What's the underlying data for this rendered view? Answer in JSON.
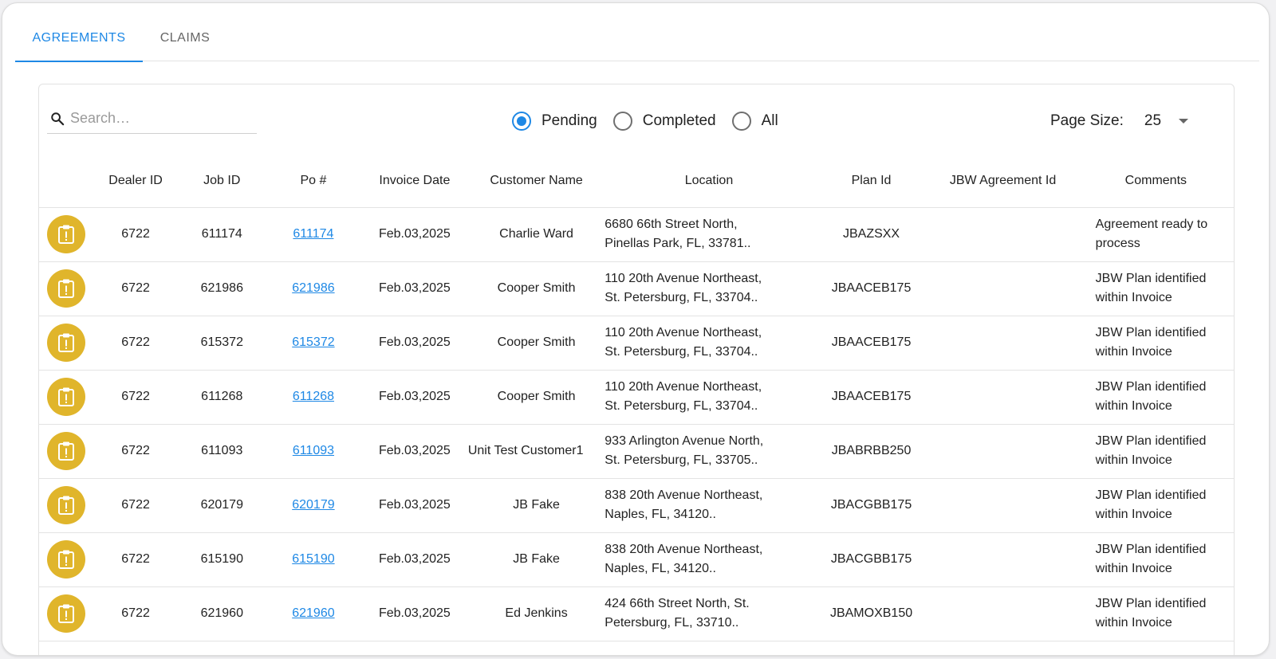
{
  "tabs": [
    {
      "label": "AGREEMENTS",
      "active": true
    },
    {
      "label": "CLAIMS",
      "active": false
    }
  ],
  "search": {
    "placeholder": "Search…",
    "value": ""
  },
  "filter": {
    "options": [
      {
        "label": "Pending",
        "checked": true
      },
      {
        "label": "Completed",
        "checked": false
      },
      {
        "label": "All",
        "checked": false
      }
    ]
  },
  "page_size": {
    "label": "Page Size:",
    "value": "25"
  },
  "table": {
    "columns": [
      "",
      "Dealer ID",
      "Job ID",
      "Po #",
      "Invoice Date",
      "Customer Name",
      "Location",
      "Plan Id",
      "JBW Agreement Id",
      "Comments"
    ],
    "rows": [
      {
        "status_icon": "clipboard-alert-icon",
        "dealer_id": "6722",
        "job_id": "611174",
        "po": "611174",
        "invoice_date": "Feb.03,2025",
        "customer": "Charlie Ward",
        "location_1": "6680 66th Street North,",
        "location_2": "Pinellas Park, FL, 33781..",
        "plan_id": "JBAZSXX",
        "agreement_id": "",
        "comment_1": "Agreement ready to",
        "comment_2": "process"
      },
      {
        "status_icon": "clipboard-alert-icon",
        "dealer_id": "6722",
        "job_id": "621986",
        "po": "621986",
        "invoice_date": "Feb.03,2025",
        "customer": "Cooper Smith",
        "location_1": "110 20th Avenue Northeast,",
        "location_2": "St. Petersburg, FL, 33704..",
        "plan_id": "JBAACEB175",
        "agreement_id": "",
        "comment_1": "JBW Plan identified",
        "comment_2": "within Invoice"
      },
      {
        "status_icon": "clipboard-alert-icon",
        "dealer_id": "6722",
        "job_id": "615372",
        "po": "615372",
        "invoice_date": "Feb.03,2025",
        "customer": "Cooper Smith",
        "location_1": "110 20th Avenue Northeast,",
        "location_2": "St. Petersburg, FL, 33704..",
        "plan_id": "JBAACEB175",
        "agreement_id": "",
        "comment_1": "JBW Plan identified",
        "comment_2": "within Invoice"
      },
      {
        "status_icon": "clipboard-alert-icon",
        "dealer_id": "6722",
        "job_id": "611268",
        "po": "611268",
        "invoice_date": "Feb.03,2025",
        "customer": "Cooper Smith",
        "location_1": "110 20th Avenue Northeast,",
        "location_2": "St. Petersburg, FL, 33704..",
        "plan_id": "JBAACEB175",
        "agreement_id": "",
        "comment_1": "JBW Plan identified",
        "comment_2": "within Invoice"
      },
      {
        "status_icon": "clipboard-alert-icon",
        "dealer_id": "6722",
        "job_id": "611093",
        "po": "611093",
        "invoice_date": "Feb.03,2025",
        "customer": "Unit Test Customer1",
        "location_1": "933 Arlington Avenue North,",
        "location_2": "St. Petersburg, FL, 33705..",
        "plan_id": "JBABRBB250",
        "agreement_id": "",
        "comment_1": "JBW Plan identified",
        "comment_2": "within Invoice"
      },
      {
        "status_icon": "clipboard-alert-icon",
        "dealer_id": "6722",
        "job_id": "620179",
        "po": "620179",
        "invoice_date": "Feb.03,2025",
        "customer": "JB Fake",
        "location_1": "838 20th Avenue Northeast,",
        "location_2": "Naples, FL, 34120..",
        "plan_id": "JBACGBB175",
        "agreement_id": "",
        "comment_1": "JBW Plan identified",
        "comment_2": "within Invoice"
      },
      {
        "status_icon": "clipboard-alert-icon",
        "dealer_id": "6722",
        "job_id": "615190",
        "po": "615190",
        "invoice_date": "Feb.03,2025",
        "customer": "JB Fake",
        "location_1": "838 20th Avenue Northeast,",
        "location_2": "Naples, FL, 34120..",
        "plan_id": "JBACGBB175",
        "agreement_id": "",
        "comment_1": "JBW Plan identified",
        "comment_2": "within Invoice"
      },
      {
        "status_icon": "clipboard-alert-icon",
        "dealer_id": "6722",
        "job_id": "621960",
        "po": "621960",
        "invoice_date": "Feb.03,2025",
        "customer": "Ed Jenkins",
        "location_1": "424 66th Street North, St.",
        "location_2": "Petersburg, FL, 33710..",
        "plan_id": "JBAMOXB150",
        "agreement_id": "",
        "comment_1": "JBW Plan identified",
        "comment_2": "within Invoice"
      }
    ]
  },
  "colors": {
    "accent": "#1e88e5",
    "status_pending": "#e0b52b"
  }
}
